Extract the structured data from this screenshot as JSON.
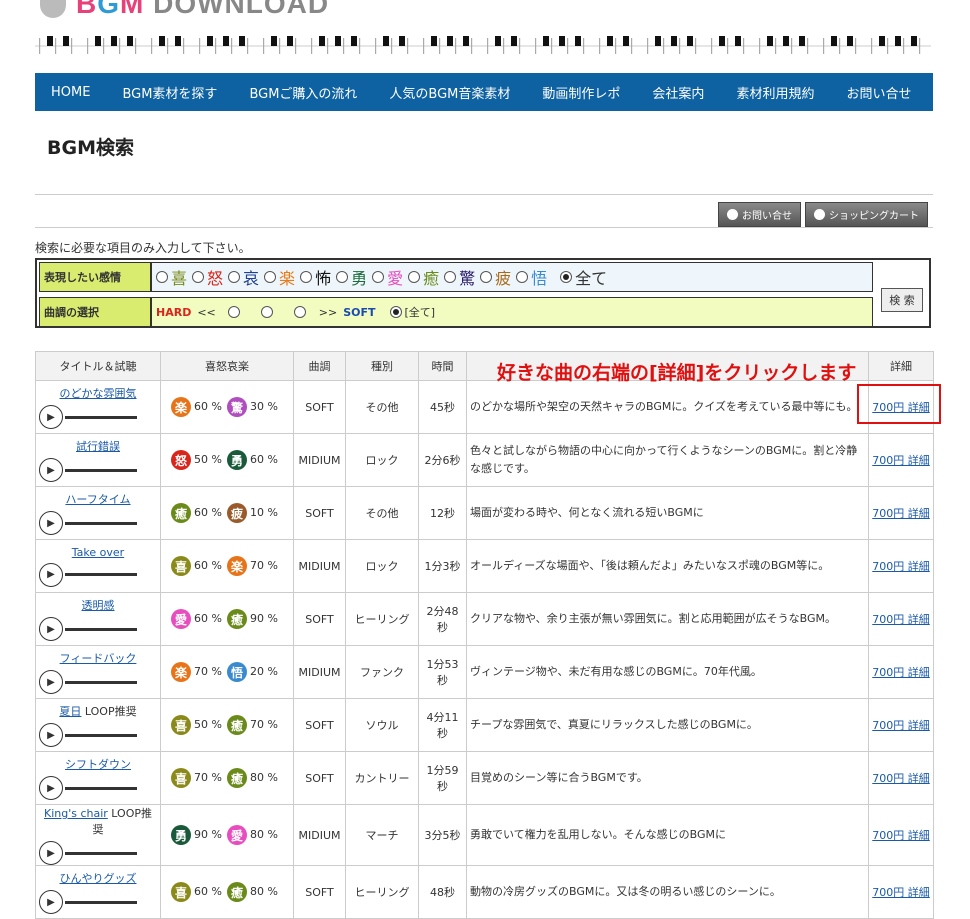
{
  "logo": {
    "part1": "B",
    "part2": "G",
    "part3": "M",
    "rest": " DOWNLOAD"
  },
  "nav": [
    "HOME",
    "BGM素材を探す",
    "BGMご購入の流れ",
    "人気のBGM音楽素材",
    "動画制作レポ",
    "会社案内",
    "素材利用規約",
    "お問い合せ"
  ],
  "page_title": "BGM検索",
  "buttons": {
    "contact": "お問い合せ",
    "cart": "ショッピングカート"
  },
  "instruction": "検索に必要な項目のみ入力して下さい。",
  "search": {
    "emotion_label": "表現したい感情",
    "emotions": [
      {
        "char": "喜",
        "color": "#7a8a1a"
      },
      {
        "char": "怒",
        "color": "#d9261c"
      },
      {
        "char": "哀",
        "color": "#1f3f8f"
      },
      {
        "char": "楽",
        "color": "#e87b1a"
      },
      {
        "char": "怖",
        "color": "#111111"
      },
      {
        "char": "勇",
        "color": "#1a6a3a"
      },
      {
        "char": "愛",
        "color": "#e84dbf"
      },
      {
        "char": "癒",
        "color": "#6a8a1a"
      },
      {
        "char": "驚",
        "color": "#2a1a6a"
      },
      {
        "char": "疲",
        "color": "#a86a1a"
      },
      {
        "char": "悟",
        "color": "#3a8ad0"
      }
    ],
    "all_label": "全て",
    "tone_label": "曲調の選択",
    "hard": "HARD",
    "arrow_left": "<<",
    "arrow_right": ">>",
    "soft": "SOFT",
    "all_bracket": "[全て]",
    "button": "検 索"
  },
  "table": {
    "headers": [
      "タイトル＆試聴",
      "喜怒哀楽",
      "曲調",
      "種別",
      "時間",
      "",
      "詳細"
    ],
    "rows": [
      {
        "title": "のどかな雰囲気",
        "suffix": "",
        "e1": {
          "char": "楽",
          "color": "#e8741a",
          "pct": "60 %"
        },
        "e2": {
          "char": "驚",
          "color": "#b04dbf",
          "pct": "30 %"
        },
        "tone": "SOFT",
        "genre": "その他",
        "time": "45秒",
        "desc": "のどかな場所や架空の天然キャラのBGMに。クイズを考えている最中等にも。",
        "link": "700円 詳細"
      },
      {
        "title": "試行錯誤",
        "suffix": "",
        "e1": {
          "char": "怒",
          "color": "#d9261c",
          "pct": "50 %"
        },
        "e2": {
          "char": "勇",
          "color": "#1a5a3a",
          "pct": "60 %"
        },
        "tone": "MIDIUM",
        "genre": "ロック",
        "time": "2分6秒",
        "desc": "色々と試しながら物語の中心に向かって行くようなシーンのBGMに。割と冷静な感じです。",
        "link": "700円 詳細"
      },
      {
        "title": "ハーフタイム",
        "suffix": "",
        "e1": {
          "char": "癒",
          "color": "#6a8a1a",
          "pct": "60 %"
        },
        "e2": {
          "char": "疲",
          "color": "#9a5a2a",
          "pct": "10 %"
        },
        "tone": "SOFT",
        "genre": "その他",
        "time": "12秒",
        "desc": "場面が変わる時や、何となく流れる短いBGMに",
        "link": "700円 詳細"
      },
      {
        "title": "Take over",
        "suffix": "",
        "e1": {
          "char": "喜",
          "color": "#8a8a1a",
          "pct": "60 %"
        },
        "e2": {
          "char": "楽",
          "color": "#e8741a",
          "pct": "70 %"
        },
        "tone": "MIDIUM",
        "genre": "ロック",
        "time": "1分3秒",
        "desc": "オールディーズな場面や、「後は頼んだよ」みたいなスポ魂のBGM等に。",
        "link": "700円 詳細"
      },
      {
        "title": "透明感",
        "suffix": "",
        "e1": {
          "char": "愛",
          "color": "#e84dbf",
          "pct": "60 %"
        },
        "e2": {
          "char": "癒",
          "color": "#6a8a1a",
          "pct": "90 %"
        },
        "tone": "SOFT",
        "genre": "ヒーリング",
        "time": "2分48秒",
        "desc": "クリアな物や、余り主張が無い雰囲気に。割と応用範囲が広そうなBGM。",
        "link": "700円 詳細"
      },
      {
        "title": "フィードバック",
        "suffix": "",
        "e1": {
          "char": "楽",
          "color": "#e8741a",
          "pct": "70 %"
        },
        "e2": {
          "char": "悟",
          "color": "#3a8ad0",
          "pct": "20 %"
        },
        "tone": "MIDIUM",
        "genre": "ファンク",
        "time": "1分53秒",
        "desc": "ヴィンテージ物や、未だ有用な感じのBGMに。70年代風。",
        "link": "700円 詳細"
      },
      {
        "title": "夏日",
        "suffix": " LOOP推奨",
        "e1": {
          "char": "喜",
          "color": "#8a8a1a",
          "pct": "50 %"
        },
        "e2": {
          "char": "癒",
          "color": "#6a8a1a",
          "pct": "70 %"
        },
        "tone": "SOFT",
        "genre": "ソウル",
        "time": "4分11秒",
        "desc": "チープな雰囲気で、真夏にリラックスした感じのBGMに。",
        "link": "700円 詳細"
      },
      {
        "title": "シフトダウン",
        "suffix": "",
        "e1": {
          "char": "喜",
          "color": "#8a8a1a",
          "pct": "70 %"
        },
        "e2": {
          "char": "癒",
          "color": "#6a8a1a",
          "pct": "80 %"
        },
        "tone": "SOFT",
        "genre": "カントリー",
        "time": "1分59秒",
        "desc": "目覚めのシーン等に合うBGMです。",
        "link": "700円 詳細"
      },
      {
        "title": "King's chair",
        "suffix": " LOOP推奨",
        "e1": {
          "char": "勇",
          "color": "#1a5a3a",
          "pct": "90 %"
        },
        "e2": {
          "char": "愛",
          "color": "#e84dbf",
          "pct": "80 %"
        },
        "tone": "MIDIUM",
        "genre": "マーチ",
        "time": "3分5秒",
        "desc": "勇敢でいて権力を乱用しない。そんな感じのBGMに",
        "link": "700円 詳細"
      },
      {
        "title": "ひんやりグッズ",
        "suffix": "",
        "e1": {
          "char": "喜",
          "color": "#8a8a1a",
          "pct": "60 %"
        },
        "e2": {
          "char": "癒",
          "color": "#6a8a1a",
          "pct": "80 %"
        },
        "tone": "SOFT",
        "genre": "ヒーリング",
        "time": "48秒",
        "desc": "動物の冷房グッズのBGMに。又は冬の明るい感じのシーンに。",
        "link": "700円 詳細"
      }
    ]
  },
  "callout": "好きな曲の右端の[詳細]をクリックします",
  "play_glyph": "▶"
}
